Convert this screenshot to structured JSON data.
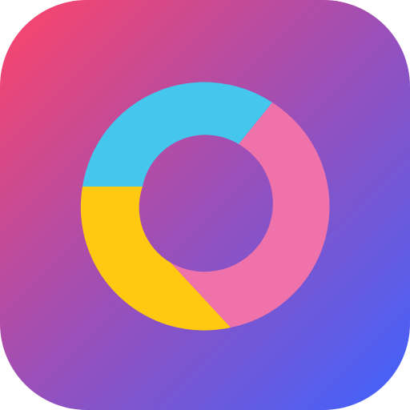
{
  "app_icon": {
    "name": "donut-chart-app-icon",
    "background_gradient": [
      "#ff4467",
      "#9b4fb8",
      "#3d63ff"
    ],
    "segments": [
      {
        "name": "segment-blue",
        "color": "#45c6ec"
      },
      {
        "name": "segment-pink",
        "color": "#ef72ab"
      },
      {
        "name": "segment-yellow",
        "color": "#ffc911"
      }
    ]
  }
}
